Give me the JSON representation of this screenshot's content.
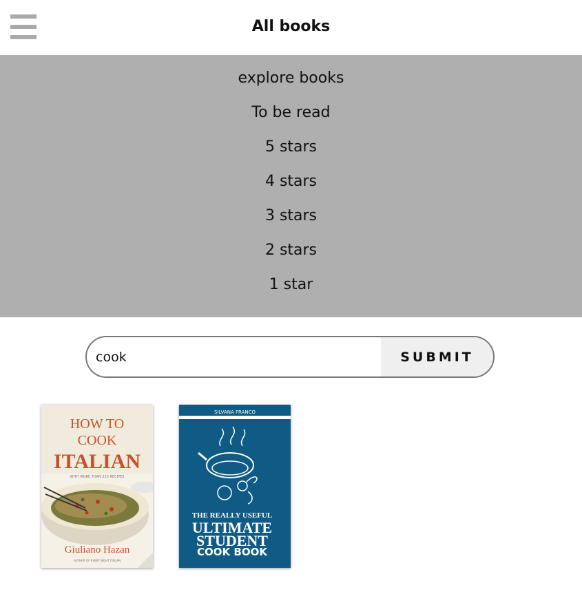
{
  "header": {
    "title": "All books",
    "menu_icon": "hamburger-menu-icon"
  },
  "menu": {
    "items": [
      {
        "label": "explore books"
      },
      {
        "label": "To be read"
      },
      {
        "label": "5 stars"
      },
      {
        "label": "4 stars"
      },
      {
        "label": "3 stars"
      },
      {
        "label": "2 stars"
      },
      {
        "label": "1 star"
      }
    ],
    "background": "#afafaf"
  },
  "search": {
    "value": "cook",
    "submit_label": "SUBMIT"
  },
  "books": [
    {
      "title_line1": "HOW TO",
      "title_line2": "COOK",
      "title_line3": "ITALIAN",
      "subtitle": "WITH MORE THAN 225 RECIPES",
      "author": "Giuliano Hazan",
      "tagline": "AUTHOR OF EVERY NIGHT ITALIAN",
      "colors": {
        "background": "#f6f1e7",
        "title": "#c8532a"
      }
    },
    {
      "author": "SILVANA FRANCO",
      "title_line1": "THE REALLY USEFUL",
      "title_line2": "ULTIMATE",
      "title_line3": "STUDENT",
      "title_line4": "COOK BOOK",
      "colors": {
        "background": "#0f5b85"
      }
    }
  ]
}
